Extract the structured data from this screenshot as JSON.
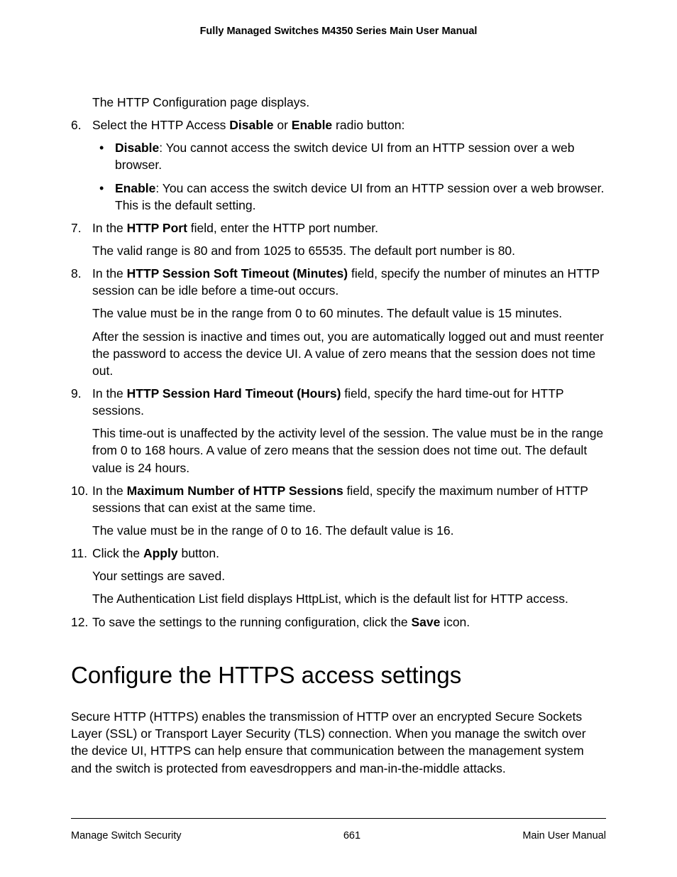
{
  "header": {
    "title": "Fully Managed Switches M4350 Series Main User Manual"
  },
  "intro": {
    "p1": "The HTTP Configuration page displays."
  },
  "step6": {
    "num": "6.",
    "lead_a": "Select the HTTP Access ",
    "bold_disable": "Disable",
    "mid_or": " or ",
    "bold_enable": "Enable",
    "tail": " radio button:",
    "bullet1_bold": "Disable",
    "bullet1_rest": ": You cannot access the switch device UI from an HTTP session over a web browser.",
    "bullet2_bold": "Enable",
    "bullet2_rest": ": You can access the switch device UI from an HTTP session over a web browser. This is the default setting."
  },
  "step7": {
    "num": "7.",
    "lead_a": "In the ",
    "bold": "HTTP Port",
    "tail": " field, enter the HTTP port number.",
    "p2": "The valid range is 80 and from 1025 to 65535. The default port number is 80."
  },
  "step8": {
    "num": "8.",
    "lead_a": "In the ",
    "bold": "HTTP Session Soft Timeout (Minutes)",
    "tail": " field, specify the number of minutes an HTTP session can be idle before a time-out occurs.",
    "p2": "The value must be in the range from 0 to 60 minutes. The default value is 15 minutes.",
    "p3": "After the session is inactive and times out, you are automatically logged out and must reenter the password to access the device UI. A value of zero means that the session does not time out."
  },
  "step9": {
    "num": "9.",
    "lead_a": "In the ",
    "bold": "HTTP Session Hard Timeout (Hours)",
    "tail": " field, specify the hard time-out for HTTP sessions.",
    "p2": "This time-out is unaffected by the activity level of the session. The value must be in the range from 0 to 168 hours. A value of zero means that the session does not time out. The default value is 24 hours."
  },
  "step10": {
    "num": "10.",
    "lead_a": "In the ",
    "bold": "Maximum Number of HTTP Sessions",
    "tail": " field, specify the maximum number of HTTP sessions that can exist at the same time.",
    "p2": "The value must be in the range of 0 to 16. The default value is 16."
  },
  "step11": {
    "num": "11.",
    "lead_a": "Click the ",
    "bold": "Apply",
    "tail": " button.",
    "p2": "Your settings are saved.",
    "p3": "The Authentication List field displays HttpList, which is the default list for HTTP access."
  },
  "step12": {
    "num": "12.",
    "lead_a": "To save the settings to the running configuration, click the ",
    "bold": "Save",
    "tail": " icon."
  },
  "section": {
    "heading": "Configure the HTTPS access settings",
    "p1": "Secure HTTP (HTTPS) enables the transmission of HTTP over an encrypted Secure Sockets Layer (SSL) or Transport Layer Security (TLS) connection. When you manage the switch over the device UI, HTTPS can help ensure that communication between the management system and the switch is protected from eavesdroppers and man-in-the-middle attacks."
  },
  "footer": {
    "left": "Manage Switch Security",
    "center": "661",
    "right": "Main User Manual"
  }
}
